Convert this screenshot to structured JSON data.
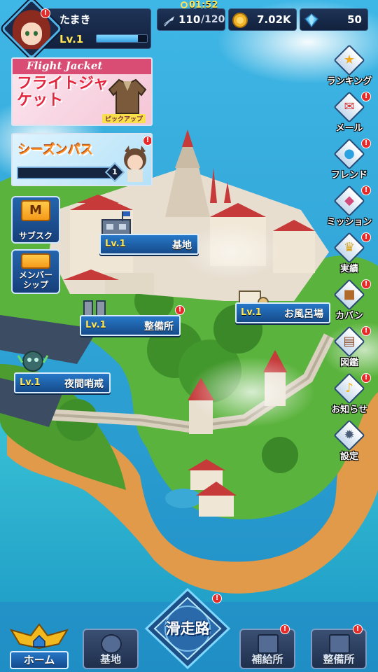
{
  "player": {
    "name": "たまき",
    "level": "Lv.1",
    "xp_fraction": 0.82
  },
  "stamina": {
    "timer": "01:52",
    "current": "110",
    "max": "/120"
  },
  "currency": {
    "coins": "7.02K",
    "gems": "50"
  },
  "banners": {
    "flight_jacket": {
      "top_text": "Flight Jacket",
      "main_text": "フライトジャケット",
      "sub_text": "ピックアップ"
    },
    "season_pass": {
      "title": "シーズンパス",
      "level": "1"
    }
  },
  "side_buttons": {
    "subscription": {
      "label": "サブスク",
      "icon_text": "M"
    },
    "membership": {
      "label": "メンバーシップ"
    }
  },
  "buildings": {
    "base": {
      "level": "Lv.1",
      "name": "基地"
    },
    "maintenance": {
      "level": "Lv.1",
      "name": "整備所"
    },
    "bath": {
      "level": "Lv.1",
      "name": "お風呂場"
    },
    "night_watch": {
      "level": "Lv.1",
      "name": "夜間哨戒"
    }
  },
  "right_menu": [
    {
      "label": "ランキング",
      "icon": "ranking-icon",
      "color": "#f2a81f"
    },
    {
      "label": "メール",
      "icon": "mail-icon",
      "color": "#d73434"
    },
    {
      "label": "フレンド",
      "icon": "friend-icon",
      "color": "#2aa1e0"
    },
    {
      "label": "ミッション",
      "icon": "mission-icon",
      "color": "#d24a7c"
    },
    {
      "label": "実績",
      "icon": "trophy-icon",
      "color": "#d9a21c"
    },
    {
      "label": "カバン",
      "icon": "bag-icon",
      "color": "#b06a2a"
    },
    {
      "label": "図鑑",
      "icon": "book-icon",
      "color": "#8a4a2a"
    },
    {
      "label": "お知らせ",
      "icon": "bell-icon",
      "color": "#f2b91f"
    },
    {
      "label": "設定",
      "icon": "gear-icon",
      "color": "#4a5d78"
    }
  ],
  "bottom_nav": {
    "home": "ホーム",
    "base": "基地",
    "runway": "滑走路",
    "supply": "補給所",
    "maintenance": "整備所"
  },
  "badge_mark": "!"
}
